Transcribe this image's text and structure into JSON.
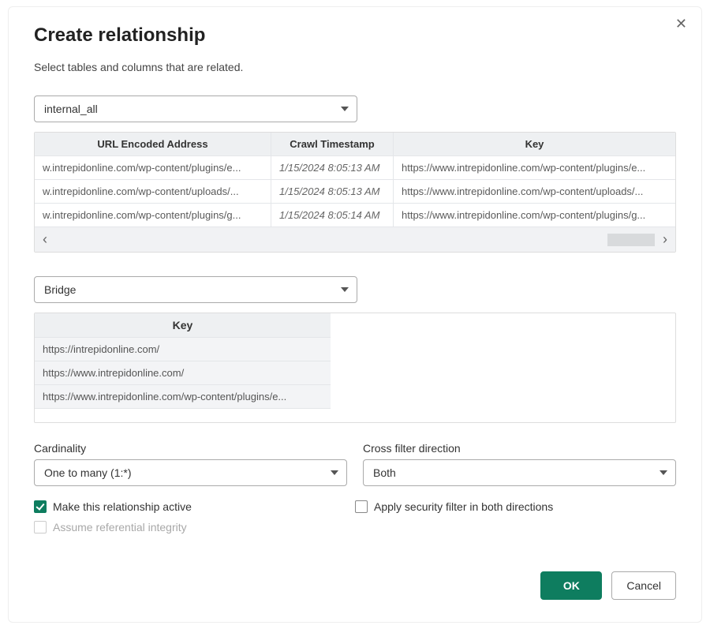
{
  "dialog": {
    "title": "Create relationship",
    "subtitle": "Select tables and columns that are related."
  },
  "table1": {
    "select_value": "internal_all",
    "headers": {
      "col1": "URL Encoded Address",
      "col2": "Crawl Timestamp",
      "col3": "Key"
    },
    "rows": [
      {
        "address": "w.intrepidonline.com/wp-content/plugins/e...",
        "ts": "1/15/2024 8:05:13 AM",
        "key": "https://www.intrepidonline.com/wp-content/plugins/e..."
      },
      {
        "address": "w.intrepidonline.com/wp-content/uploads/...",
        "ts": "1/15/2024 8:05:13 AM",
        "key": "https://www.intrepidonline.com/wp-content/uploads/..."
      },
      {
        "address": "w.intrepidonline.com/wp-content/plugins/g...",
        "ts": "1/15/2024 8:05:14 AM",
        "key": "https://www.intrepidonline.com/wp-content/plugins/g..."
      }
    ]
  },
  "table2": {
    "select_value": "Bridge",
    "header": "Key",
    "rows": [
      "https://intrepidonline.com/",
      "https://www.intrepidonline.com/",
      "https://www.intrepidonline.com/wp-content/plugins/e..."
    ]
  },
  "options": {
    "cardinality_label": "Cardinality",
    "cardinality_value": "One to many (1:*)",
    "crossfilter_label": "Cross filter direction",
    "crossfilter_value": "Both"
  },
  "checks": {
    "active_label": "Make this relationship active",
    "active_checked": true,
    "ref_integrity_label": "Assume referential integrity",
    "ref_integrity_checked": false,
    "security_label": "Apply security filter in both directions",
    "security_checked": false
  },
  "footer": {
    "ok": "OK",
    "cancel": "Cancel"
  }
}
